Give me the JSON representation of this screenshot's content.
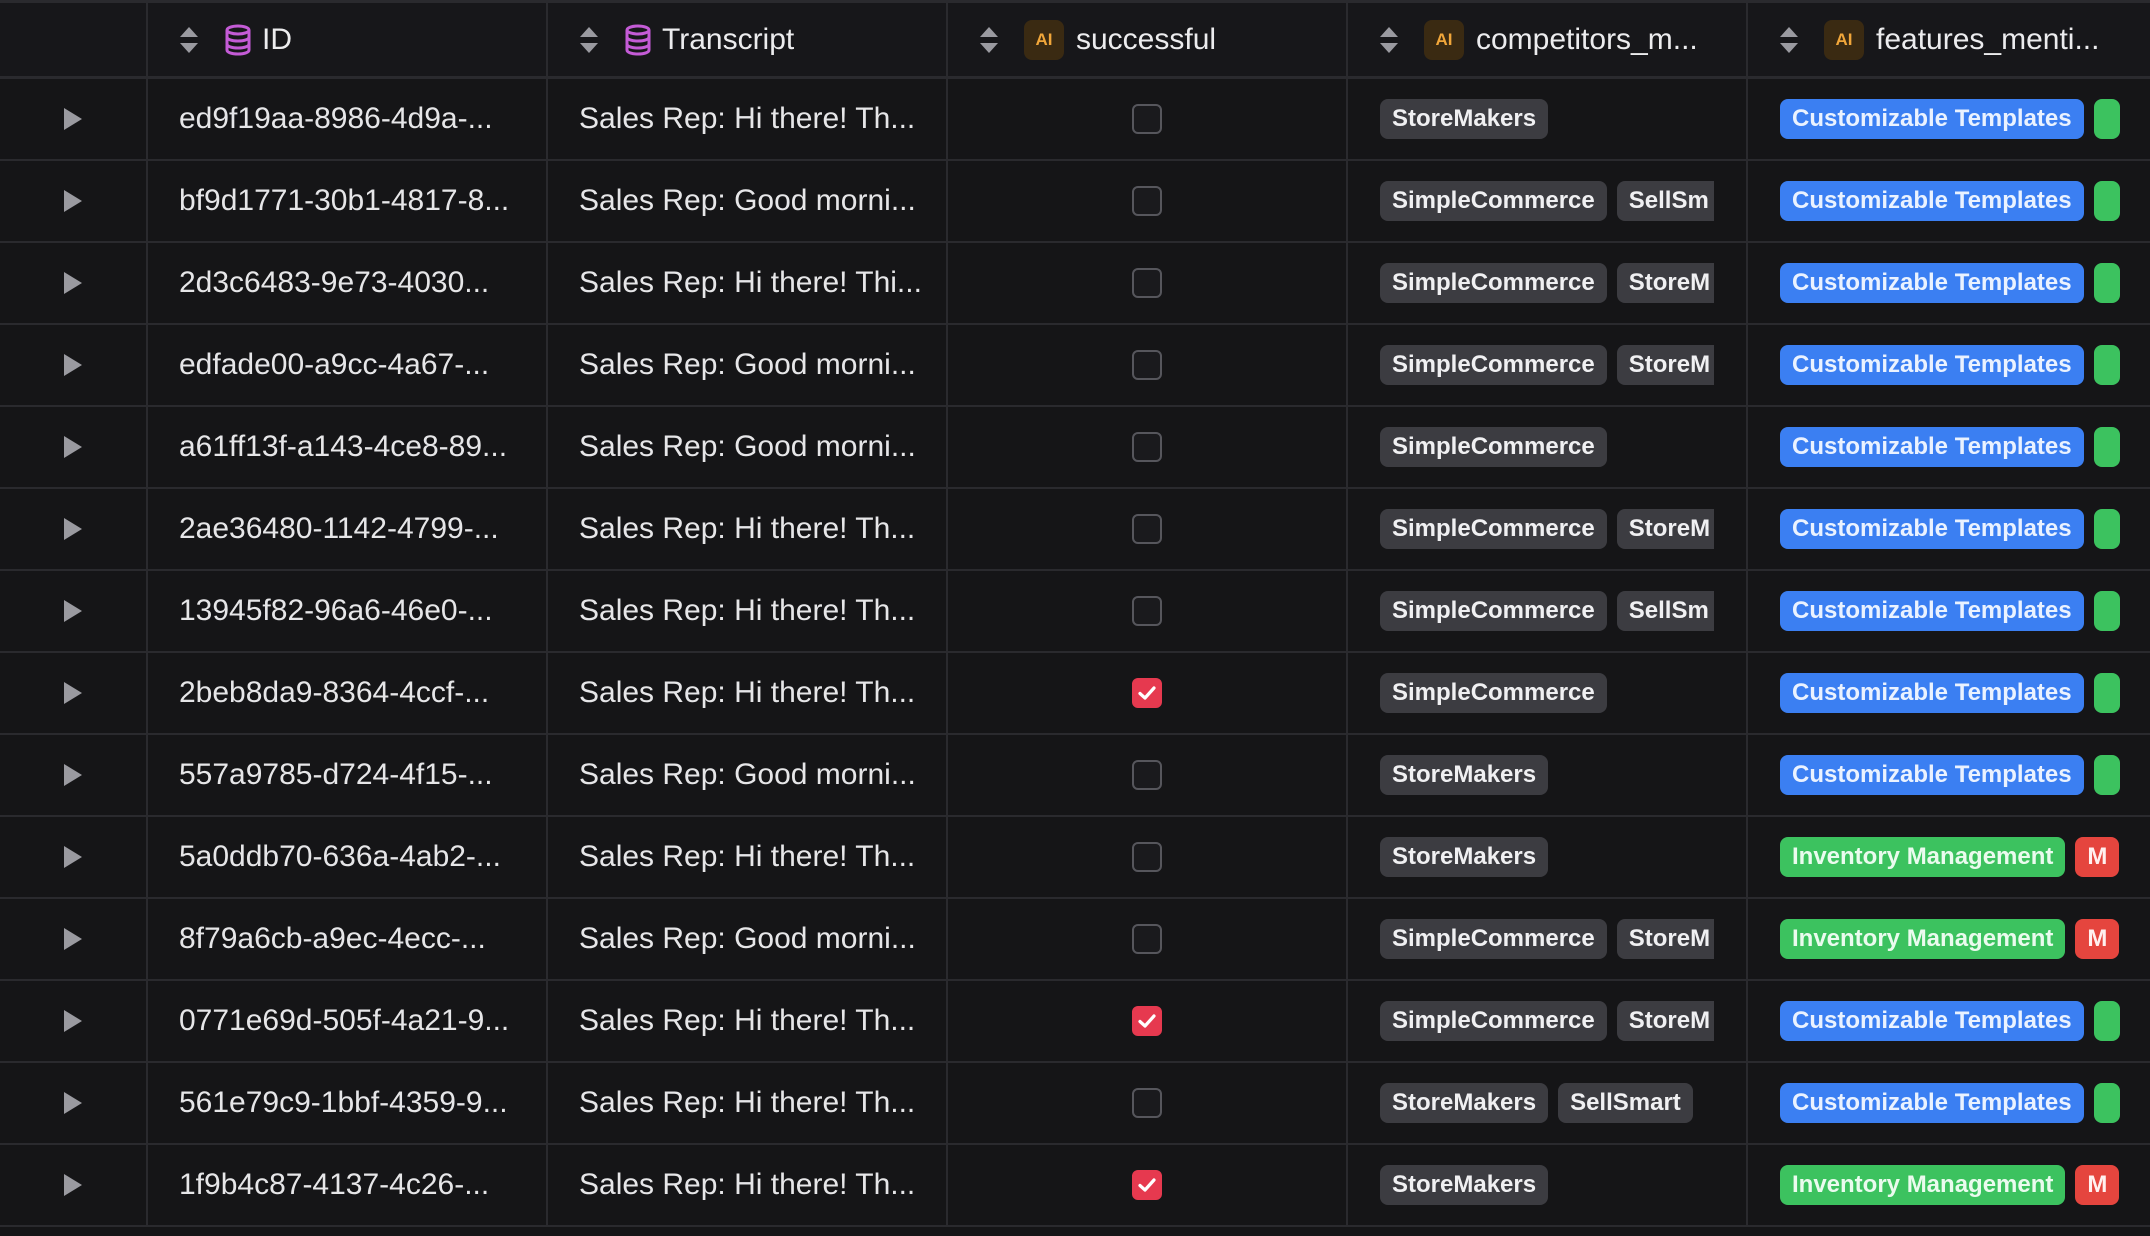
{
  "columns": {
    "id": "ID",
    "transcript": "Transcript",
    "successful": "successful",
    "competitors": "competitors_m...",
    "features": "features_menti...",
    "ai_badge": "AI"
  },
  "icons": {
    "sort": "sort-updown-icon",
    "database": "database-icon",
    "expand": "play-triangle-icon",
    "check": "checkmark-icon"
  },
  "colors": {
    "accent_check": "#e6394f",
    "db_icon": "#c45bd6",
    "ai_badge_text": "#f0a63a",
    "tag_blue": "#3b7ff2",
    "tag_green": "#3cc25f",
    "tag_red": "#e5453e",
    "tag_gray": "#3c3c41"
  },
  "rows": [
    {
      "id": "ed9f19aa-8986-4d9a-...",
      "transcript": "Sales Rep: Hi there! Th...",
      "successful": false,
      "competitors": [
        "StoreMakers"
      ],
      "features": [
        {
          "label": "Customizable Templates",
          "color": "blue"
        },
        {
          "label": "",
          "color": "green"
        }
      ]
    },
    {
      "id": "bf9d1771-30b1-4817-8...",
      "transcript": "Sales Rep: Good morni...",
      "successful": false,
      "competitors": [
        "SimpleCommerce",
        "SellSm"
      ],
      "features": [
        {
          "label": "Customizable Templates",
          "color": "blue"
        },
        {
          "label": "",
          "color": "green"
        }
      ]
    },
    {
      "id": "2d3c6483-9e73-4030...",
      "transcript": "Sales Rep: Hi there! Thi...",
      "successful": false,
      "competitors": [
        "SimpleCommerce",
        "StoreM"
      ],
      "features": [
        {
          "label": "Customizable Templates",
          "color": "blue"
        },
        {
          "label": "",
          "color": "green"
        }
      ]
    },
    {
      "id": "edfade00-a9cc-4a67-...",
      "transcript": "Sales Rep: Good morni...",
      "successful": false,
      "competitors": [
        "SimpleCommerce",
        "StoreM"
      ],
      "features": [
        {
          "label": "Customizable Templates",
          "color": "blue"
        },
        {
          "label": "",
          "color": "green"
        }
      ]
    },
    {
      "id": "a61ff13f-a143-4ce8-89...",
      "transcript": "Sales Rep: Good morni...",
      "successful": false,
      "competitors": [
        "SimpleCommerce"
      ],
      "features": [
        {
          "label": "Customizable Templates",
          "color": "blue"
        },
        {
          "label": "",
          "color": "green"
        }
      ]
    },
    {
      "id": "2ae36480-1142-4799-...",
      "transcript": "Sales Rep: Hi there! Th...",
      "successful": false,
      "competitors": [
        "SimpleCommerce",
        "StoreM"
      ],
      "features": [
        {
          "label": "Customizable Templates",
          "color": "blue"
        },
        {
          "label": "",
          "color": "green"
        }
      ]
    },
    {
      "id": "13945f82-96a6-46e0-...",
      "transcript": "Sales Rep: Hi there! Th...",
      "successful": false,
      "competitors": [
        "SimpleCommerce",
        "SellSm"
      ],
      "features": [
        {
          "label": "Customizable Templates",
          "color": "blue"
        },
        {
          "label": "",
          "color": "green"
        }
      ]
    },
    {
      "id": "2beb8da9-8364-4ccf-...",
      "transcript": "Sales Rep: Hi there! Th...",
      "successful": true,
      "competitors": [
        "SimpleCommerce"
      ],
      "features": [
        {
          "label": "Customizable Templates",
          "color": "blue"
        },
        {
          "label": "",
          "color": "green"
        }
      ]
    },
    {
      "id": "557a9785-d724-4f15-...",
      "transcript": "Sales Rep: Good morni...",
      "successful": false,
      "competitors": [
        "StoreMakers"
      ],
      "features": [
        {
          "label": "Customizable Templates",
          "color": "blue"
        },
        {
          "label": "",
          "color": "green"
        }
      ]
    },
    {
      "id": "5a0ddb70-636a-4ab2-...",
      "transcript": "Sales Rep: Hi there! Th...",
      "successful": false,
      "competitors": [
        "StoreMakers"
      ],
      "features": [
        {
          "label": "Inventory Management",
          "color": "green"
        },
        {
          "label": "M",
          "color": "red"
        }
      ]
    },
    {
      "id": "8f79a6cb-a9ec-4ecc-...",
      "transcript": "Sales Rep: Good morni...",
      "successful": false,
      "competitors": [
        "SimpleCommerce",
        "StoreM"
      ],
      "features": [
        {
          "label": "Inventory Management",
          "color": "green"
        },
        {
          "label": "M",
          "color": "red"
        }
      ]
    },
    {
      "id": "0771e69d-505f-4a21-9...",
      "transcript": "Sales Rep: Hi there! Th...",
      "successful": true,
      "competitors": [
        "SimpleCommerce",
        "StoreM"
      ],
      "features": [
        {
          "label": "Customizable Templates",
          "color": "blue"
        },
        {
          "label": "",
          "color": "green"
        }
      ]
    },
    {
      "id": "561e79c9-1bbf-4359-9...",
      "transcript": "Sales Rep: Hi there! Th...",
      "successful": false,
      "competitors": [
        "StoreMakers",
        "SellSmart"
      ],
      "features": [
        {
          "label": "Customizable Templates",
          "color": "blue"
        },
        {
          "label": "",
          "color": "green"
        }
      ]
    },
    {
      "id": "1f9b4c87-4137-4c26-...",
      "transcript": "Sales Rep: Hi there! Th...",
      "successful": true,
      "competitors": [
        "StoreMakers"
      ],
      "features": [
        {
          "label": "Inventory Management",
          "color": "green"
        },
        {
          "label": "M",
          "color": "red"
        }
      ]
    }
  ]
}
